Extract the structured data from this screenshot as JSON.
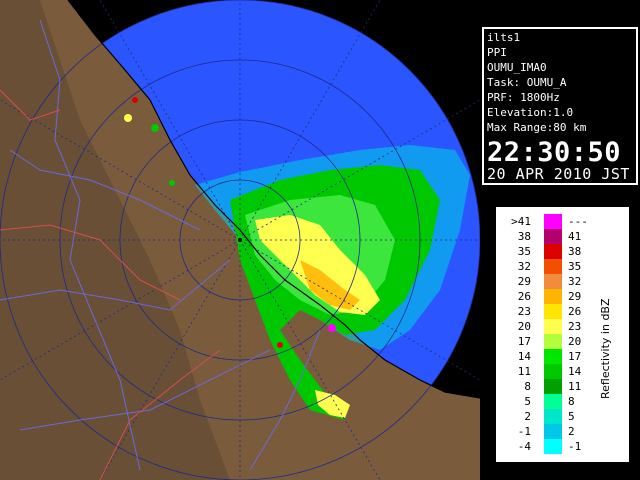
{
  "info": {
    "site": "ilts1",
    "product": "PPI",
    "station": "OUMU_IMA0",
    "task": "Task: OUMU_A",
    "prf": "PRF: 1800Hz",
    "elevation": "Elevation:1.0",
    "max_range": "Max Range:80 km",
    "time": "22:30:50",
    "date": "20 APR 2010 JST"
  },
  "legend": {
    "title": "Reflectivity in dBZ",
    "rows": [
      {
        "left": ">41",
        "right": "---",
        "color": "#ff00ff"
      },
      {
        "left": "38",
        "right": "41",
        "color": "#b4006e"
      },
      {
        "left": "35",
        "right": "38",
        "color": "#dc0000"
      },
      {
        "left": "32",
        "right": "35",
        "color": "#f05000"
      },
      {
        "left": "29",
        "right": "32",
        "color": "#f08c3c"
      },
      {
        "left": "26",
        "right": "29",
        "color": "#ffb400"
      },
      {
        "left": "23",
        "right": "26",
        "color": "#ffe600"
      },
      {
        "left": "20",
        "right": "23",
        "color": "#ffff50"
      },
      {
        "left": "17",
        "right": "20",
        "color": "#b4ff3c"
      },
      {
        "left": "14",
        "right": "17",
        "color": "#00e600"
      },
      {
        "left": "11",
        "right": "14",
        "color": "#00c800"
      },
      {
        "left": "8",
        "right": "11",
        "color": "#00a000"
      },
      {
        "left": "5",
        "right": "8",
        "color": "#00ff96"
      },
      {
        "left": "2",
        "right": "5",
        "color": "#00e6c8"
      },
      {
        "left": "-1",
        "right": "2",
        "color": "#00c8e6"
      },
      {
        "left": "-4",
        "right": "-1",
        "color": "#00ffff"
      }
    ]
  },
  "colors": {
    "background": "#000000",
    "radar_range": "#1a46ff",
    "land": "#8c6a46"
  }
}
